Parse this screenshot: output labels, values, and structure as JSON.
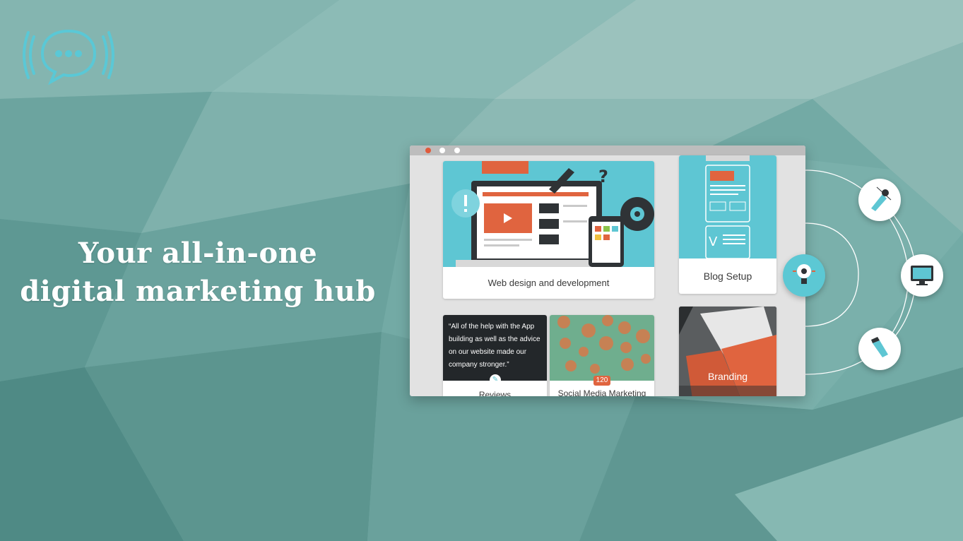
{
  "headline": {
    "line1": "Your all-in-one",
    "line2": "digital marketing hub"
  },
  "logo": {
    "icon": "chat-bubble-broadcast-icon"
  },
  "browser": {
    "cards": {
      "web_design": {
        "label": "Web design and development"
      },
      "blog": {
        "label": "Blog Setup"
      },
      "reviews": {
        "quote": "“All of the help with the App building as well as the advice on our website made our company stronger.”",
        "label": "Reviews"
      },
      "social": {
        "label": "Social Media Marketing",
        "count": "120"
      },
      "branding": {
        "label": "Branding"
      }
    }
  },
  "service_icons": [
    "lightbulb-gear-icon",
    "pen-tool-icon",
    "monitor-icon",
    "pencil-icon"
  ],
  "colors": {
    "accent_teal": "#5cc8d4",
    "accent_orange": "#e0643f",
    "background": "#6fa8a3"
  }
}
